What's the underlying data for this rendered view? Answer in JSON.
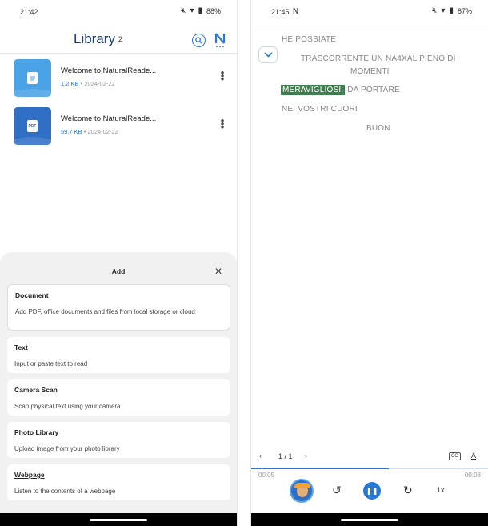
{
  "left": {
    "status": {
      "time": "21:42",
      "battery": "88%"
    },
    "header": {
      "title": "Library",
      "count": "2"
    },
    "files": [
      {
        "name": "Welcome to NaturalReade...",
        "size": "1.2 KB",
        "date": "2024-02-22",
        "type": "doc",
        "badge": ""
      },
      {
        "name": "Welcome to NaturalReade...",
        "size": "59.7 KB",
        "date": "2024-02-22",
        "type": "pdf",
        "badge": "PDF"
      }
    ],
    "sheet": {
      "title": "Add",
      "options": [
        {
          "title": "Document",
          "desc": "Add PDF, office documents and files from local storage or cloud"
        },
        {
          "title": "Text",
          "desc": "Input or paste text to read"
        },
        {
          "title": "Camera Scan",
          "desc": "Scan physical text using your camera"
        },
        {
          "title": "Photo Library",
          "desc": "Upload image from your photo library"
        },
        {
          "title": "Webpage",
          "desc": "Listen to the contents of a webpage"
        }
      ]
    }
  },
  "right": {
    "status": {
      "time": "21:45",
      "battery": "87%"
    },
    "reader_lines": {
      "line1": "HE POSSIATE",
      "line2": "TRASCORRENTE UN NA4XAL PIENO DI",
      "line3": "MOMENTI",
      "highlight": "MERAVIGLIOSI,",
      "line4_rest": " DA PORTARE",
      "line5": "NEI VOSTRI CUORI",
      "line6": "BUON"
    },
    "toolbar": {
      "page": "1 / 1",
      "cc_label": "CC",
      "font_label": "A"
    },
    "player": {
      "elapsed": "00:05",
      "total": "00:08",
      "progress": 0.58,
      "speed": "1x"
    }
  },
  "colors": {
    "accent": "#2878d6",
    "highlight": "#3e7d4d",
    "title": "#1a3d7c"
  },
  "icons": [
    "wifi-icon",
    "battery-icon",
    "mute-icon",
    "search-icon",
    "naturalreader-logo-icon",
    "more-vert-icon",
    "close-icon",
    "chevron-down-icon",
    "chevron-left-icon",
    "chevron-right-icon",
    "closed-caption-icon",
    "text-size-icon",
    "rewind-icon",
    "pause-icon",
    "forward-icon"
  ]
}
